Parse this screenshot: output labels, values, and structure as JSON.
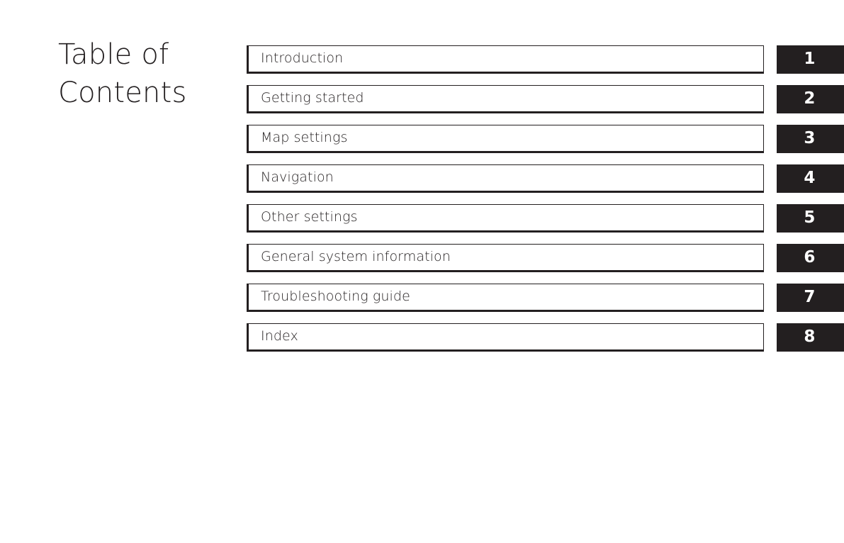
{
  "page": {
    "background_color": "#ffffff",
    "text_color": "#231f20",
    "badge_color": "#231f20",
    "badge_text_color": "#ffffff"
  },
  "title": "Table of\nContents",
  "contents": {
    "entries": [
      {
        "label": "Introduction",
        "number": "1"
      },
      {
        "label": "Getting started",
        "number": "2"
      },
      {
        "label": "Map settings",
        "number": "3"
      },
      {
        "label": "Navigation",
        "number": "4"
      },
      {
        "label": "Other settings",
        "number": "5"
      },
      {
        "label": "General system information",
        "number": "6"
      },
      {
        "label": "Troubleshooting guide",
        "number": "7"
      },
      {
        "label": "Index",
        "number": "8"
      }
    ]
  }
}
